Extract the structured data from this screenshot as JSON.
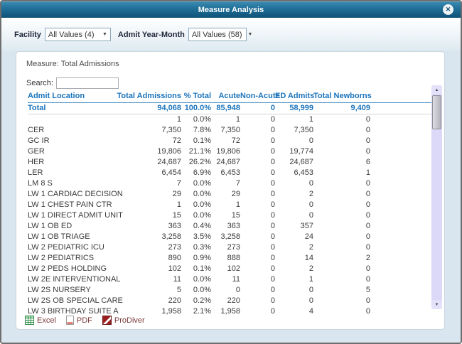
{
  "dialog": {
    "title": "Measure Analysis"
  },
  "icons": {
    "close": "✕",
    "dropdown_arrow": "▼",
    "scroll_up": "▲",
    "scroll_down": "▼"
  },
  "filters": {
    "facility_label": "Facility",
    "facility_value": "All Values (4)",
    "admit_label": "Admit Year-Month",
    "admit_value": "All Values (58)"
  },
  "panel": {
    "measure_label": "Measure: Total Admissions",
    "search_label": "Search:",
    "search_value": ""
  },
  "table": {
    "columns": [
      "Admit Location",
      "Total Admissions",
      "% Total",
      "Acute",
      "Non-Acute",
      "ED Admits",
      "Total Newborns"
    ],
    "column_keys": [
      "admit_location",
      "total_admissions",
      "pct_total",
      "acute",
      "non_acute",
      "ed_admits",
      "total_newborns"
    ],
    "total_row": [
      "Total",
      "94,068",
      "100.0%",
      "85,948",
      "0",
      "58,999",
      "9,409"
    ],
    "rows": [
      [
        "",
        "1",
        "0.0%",
        "1",
        "0",
        "1",
        "0"
      ],
      [
        "CER",
        "7,350",
        "7.8%",
        "7,350",
        "0",
        "7,350",
        "0"
      ],
      [
        "GC IR",
        "72",
        "0.1%",
        "72",
        "0",
        "0",
        "0"
      ],
      [
        "GER",
        "19,806",
        "21.1%",
        "19,806",
        "0",
        "19,774",
        "0"
      ],
      [
        "HER",
        "24,687",
        "26.2%",
        "24,687",
        "0",
        "24,687",
        "6"
      ],
      [
        "LER",
        "6,454",
        "6.9%",
        "6,453",
        "0",
        "6,453",
        "1"
      ],
      [
        "LM 8 S",
        "7",
        "0.0%",
        "7",
        "0",
        "0",
        "0"
      ],
      [
        "LW 1 CARDIAC DECISION",
        "29",
        "0.0%",
        "29",
        "0",
        "2",
        "0"
      ],
      [
        "LW 1 CHEST PAIN CTR",
        "1",
        "0.0%",
        "1",
        "0",
        "0",
        "0"
      ],
      [
        "LW 1 DIRECT ADMIT UNIT",
        "15",
        "0.0%",
        "15",
        "0",
        "0",
        "0"
      ],
      [
        "LW 1 OB ED",
        "363",
        "0.4%",
        "363",
        "0",
        "357",
        "0"
      ],
      [
        "LW 1 OB TRIAGE",
        "3,258",
        "3.5%",
        "3,258",
        "0",
        "24",
        "0"
      ],
      [
        "LW 2 PEDIATRIC ICU",
        "273",
        "0.3%",
        "273",
        "0",
        "2",
        "0"
      ],
      [
        "LW 2 PEDIATRICS",
        "890",
        "0.9%",
        "888",
        "0",
        "14",
        "2"
      ],
      [
        "LW 2 PEDS HOLDING",
        "102",
        "0.1%",
        "102",
        "0",
        "2",
        "0"
      ],
      [
        "LW 2E INTERVENTIONAL",
        "11",
        "0.0%",
        "11",
        "0",
        "1",
        "0"
      ],
      [
        "LW 2S NURSERY",
        "5",
        "0.0%",
        "0",
        "0",
        "0",
        "5"
      ],
      [
        "LW 2S OB SPECIAL CARE",
        "220",
        "0.2%",
        "220",
        "0",
        "0",
        "0"
      ],
      [
        "LW 3 BIRTHDAY SUITE A",
        "1,958",
        "2.1%",
        "1,958",
        "0",
        "4",
        "0"
      ]
    ]
  },
  "footer": {
    "excel_label": "Excel",
    "pdf_label": "PDF",
    "prodiver_label": "ProDiver"
  },
  "colors": {
    "accent": "#1b74bc",
    "titlebar_top": "#3c8cb4",
    "titlebar_bottom": "#0f5277",
    "maroon": "#7b3b3b",
    "scroll_track": "#dcd9f8"
  }
}
